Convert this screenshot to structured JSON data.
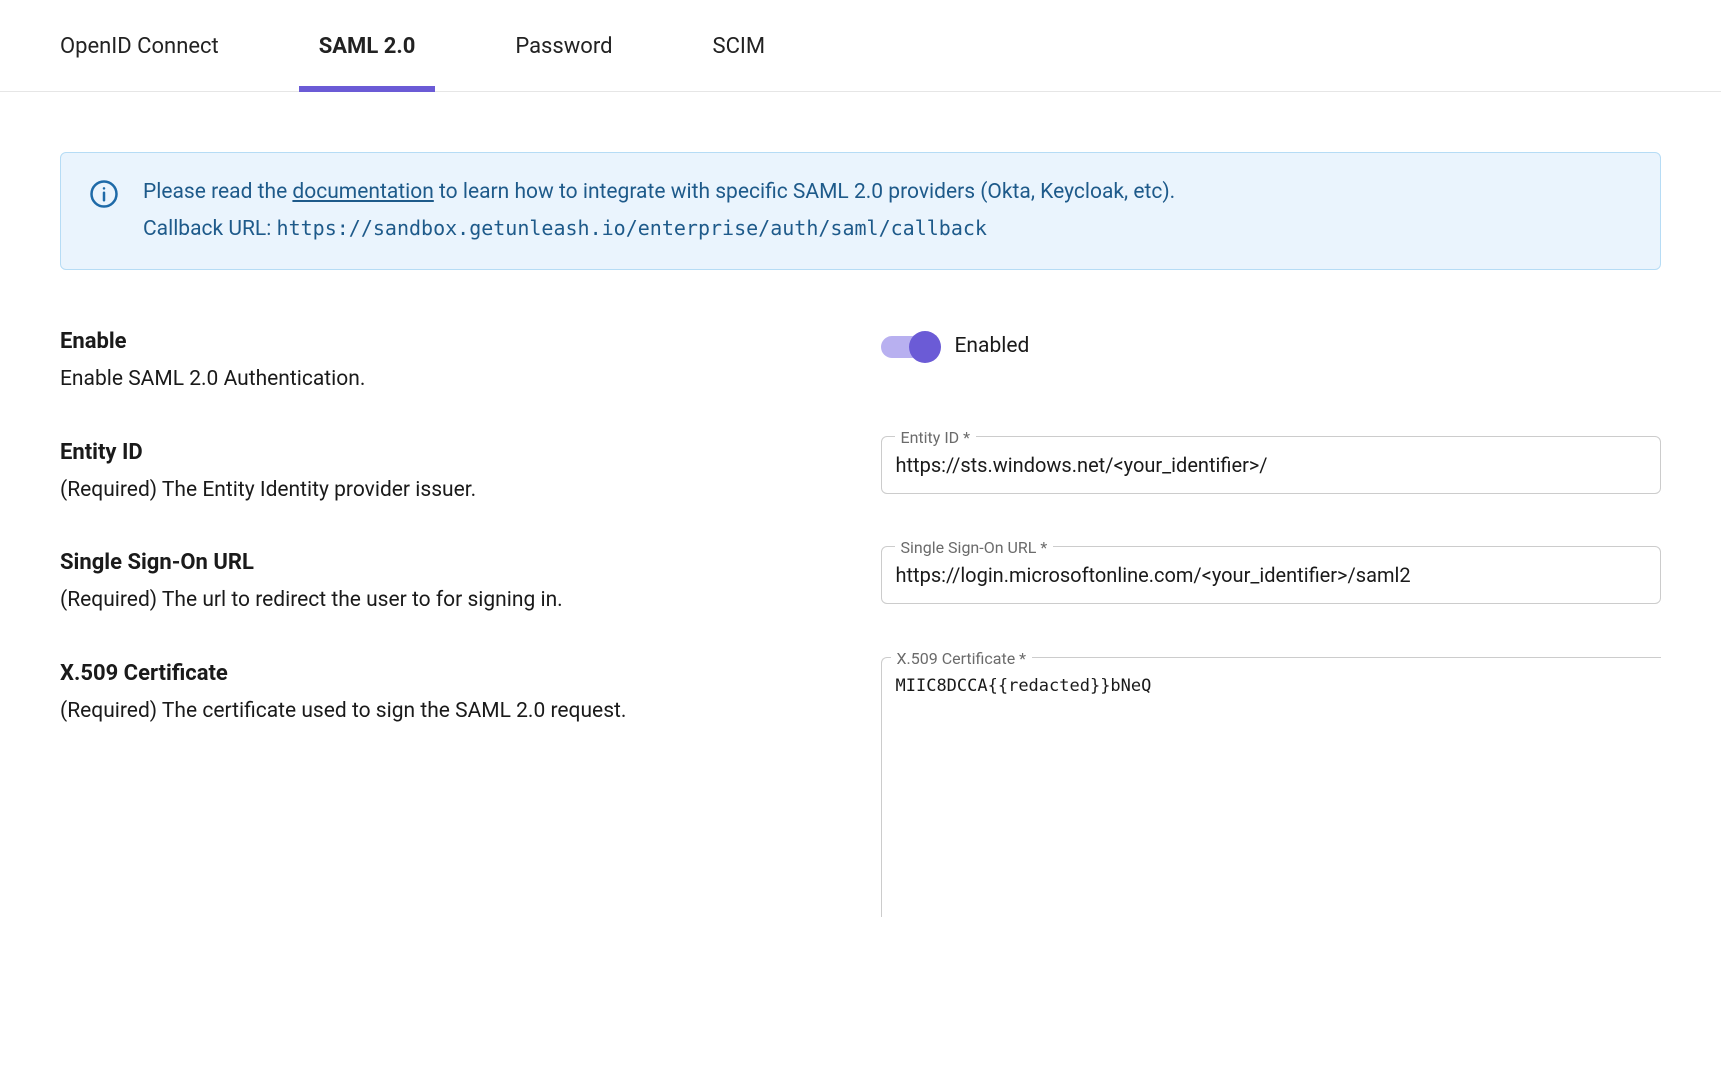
{
  "tabs": {
    "openid": "OpenID Connect",
    "saml": "SAML 2.0",
    "password": "Password",
    "scim": "SCIM"
  },
  "info": {
    "prefix": "Please read the ",
    "doc_link": "documentation",
    "suffix": " to learn how to integrate with specific SAML 2.0 providers (Okta, Keycloak, etc).",
    "callback_label": "Callback URL: ",
    "callback_url": "https://sandbox.getunleash.io/enterprise/auth/saml/callback"
  },
  "fields": {
    "enable": {
      "title": "Enable",
      "desc": "Enable SAML 2.0 Authentication.",
      "toggle_label": "Enabled"
    },
    "entity_id": {
      "title": "Entity ID",
      "desc": "(Required) The Entity Identity provider issuer.",
      "label": "Entity ID *",
      "value": "https://sts.windows.net/<your_identifier>/"
    },
    "sso_url": {
      "title": "Single Sign-On URL",
      "desc": "(Required) The url to redirect the user to for signing in.",
      "label": "Single Sign-On URL *",
      "value": "https://login.microsoftonline.com/<your_identifier>/saml2"
    },
    "cert": {
      "title": "X.509 Certificate",
      "desc": "(Required) The certificate used to sign the SAML 2.0 request.",
      "label": "X.509 Certificate *",
      "value": "MIIC8DCCA{{redacted}}bNeQ"
    }
  }
}
